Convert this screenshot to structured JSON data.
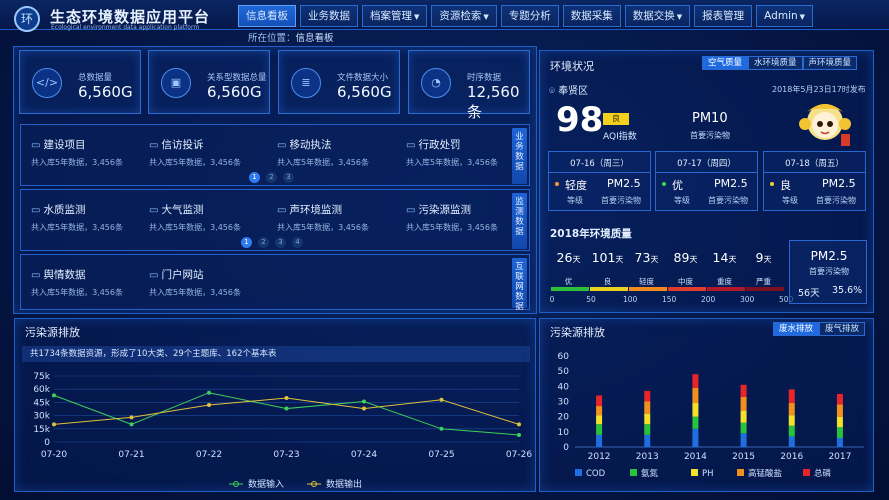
{
  "header": {
    "logo": "环",
    "title": "生态环境数据应用平台",
    "subtitle": "Ecological environment data application platform"
  },
  "nav": [
    {
      "label": "信息看板",
      "active": true,
      "caret": false
    },
    {
      "label": "业务数据",
      "active": false,
      "caret": false
    },
    {
      "label": "档案管理",
      "active": false,
      "caret": true
    },
    {
      "label": "资源检索",
      "active": false,
      "caret": true
    },
    {
      "label": "专题分析",
      "active": false,
      "caret": false
    },
    {
      "label": "数据采集",
      "active": false,
      "caret": false
    },
    {
      "label": "数据交换",
      "active": false,
      "caret": true
    },
    {
      "label": "报表管理",
      "active": false,
      "caret": false
    },
    {
      "label": "Admin",
      "active": false,
      "caret": true
    }
  ],
  "breadcrumb": {
    "prefix": "所在位置：",
    "current": "信息看板"
  },
  "stats": [
    {
      "icon": "</>",
      "label": "总数据量",
      "value": "6,560G"
    },
    {
      "icon": "▣",
      "label": "关系型数据总量",
      "value": "6,560G"
    },
    {
      "icon": "≣",
      "label": "文件数据大小",
      "value": "6,560G"
    },
    {
      "icon": "◔",
      "label": "时序数据",
      "value": "12,560条"
    }
  ],
  "groups": [
    {
      "side": "业务数据",
      "items": [
        {
          "name": "建设项目",
          "sub": "共入库5年数据，3,456条"
        },
        {
          "name": "信访投诉",
          "sub": "共入库5年数据，3,456条"
        },
        {
          "name": "移动执法",
          "sub": "共入库5年数据，3,456条"
        },
        {
          "name": "行政处罚",
          "sub": "共入库5年数据，3,456条"
        }
      ],
      "pages": [
        "1",
        "2",
        "3"
      ]
    },
    {
      "side": "监测数据",
      "items": [
        {
          "name": "水质监测",
          "sub": "共入库5年数据，3,456条"
        },
        {
          "name": "大气监测",
          "sub": "共入库5年数据，3,456条"
        },
        {
          "name": "声环境监测",
          "sub": "共入库5年数据，3,456条"
        },
        {
          "name": "污染源监测",
          "sub": "共入库5年数据，3,456条"
        }
      ],
      "pages": [
        "1",
        "2",
        "3",
        "4"
      ]
    },
    {
      "side": "互联网数据",
      "items": [
        {
          "name": "舆情数据",
          "sub": "共入库5年数据，3,456条"
        },
        {
          "name": "门户网站",
          "sub": "共入库5年数据，3,456条"
        }
      ],
      "pages": []
    }
  ],
  "env": {
    "title": "环境状况",
    "tabs": [
      "空气质量",
      "水环境质量",
      "声环境质量"
    ],
    "location": "奉贤区",
    "date": "2018年5月23日17时发布",
    "aqi": "98",
    "aqi_level": "良",
    "aqi_label": "AQI指数",
    "main_pollutant": "PM10",
    "main_pollutant_label": "首要污染物",
    "forecast": [
      {
        "date": "07-16（周三）",
        "level": "轻度",
        "level_color": "#f0a030",
        "level_label": "等级",
        "pollutant": "PM2.5",
        "pollutant_label": "首要污染物"
      },
      {
        "date": "07-17（周四）",
        "level": "优",
        "level_color": "#39d353",
        "level_label": "等级",
        "pollutant": "PM2.5",
        "pollutant_label": "首要污染物"
      },
      {
        "date": "07-18（周五）",
        "level": "良",
        "level_color": "#f0d030",
        "level_label": "等级",
        "pollutant": "PM2.5",
        "pollutant_label": "首要污染物"
      }
    ],
    "year_title": "2018年环境质量",
    "year_levels": [
      {
        "days": "26",
        "unit": "天",
        "label": "优",
        "color": "#2bbf3c"
      },
      {
        "days": "101",
        "unit": "天",
        "label": "良",
        "color": "#e8d21f"
      },
      {
        "days": "73",
        "unit": "天",
        "label": "轻度",
        "color": "#f08a1c"
      },
      {
        "days": "89",
        "unit": "天",
        "label": "中度",
        "color": "#e23b2b"
      },
      {
        "days": "14",
        "unit": "天",
        "label": "重度",
        "color": "#b3182a"
      },
      {
        "days": "9",
        "unit": "天",
        "label": "严重",
        "color": "#7a0f22"
      }
    ],
    "scale_ticks": [
      "0",
      "50",
      "100",
      "150",
      "200",
      "300",
      "500"
    ],
    "year_pollutant": "PM2.5",
    "year_pollutant_label": "首要污染物",
    "year_days": "56天",
    "year_pct": "35.6%"
  },
  "line_panel": {
    "title": "污染源排放",
    "summary": "共1734条数据资源，形成了10大类、29个主题库、162个基本表"
  },
  "bar_panel": {
    "title": "污染源排放",
    "tabs": [
      "废水排放",
      "废气排放"
    ]
  },
  "chart_data": [
    {
      "type": "line",
      "title": "",
      "x": [
        "07-20",
        "07-21",
        "07-22",
        "07-23",
        "07-24",
        "07-25",
        "07-26"
      ],
      "ylim": [
        0,
        75000
      ],
      "yticks": [
        "0",
        "15k",
        "30k",
        "45k",
        "60k",
        "75k"
      ],
      "series": [
        {
          "name": "数据输入",
          "color": "#3fd05a",
          "values": [
            53000,
            20000,
            56000,
            38000,
            46000,
            15000,
            8000
          ]
        },
        {
          "name": "数据输出",
          "color": "#e0c23a",
          "values": [
            20000,
            28000,
            42000,
            50000,
            38000,
            48000,
            20000
          ]
        }
      ],
      "legend": "bottom"
    },
    {
      "type": "bar",
      "title": "",
      "categories": [
        "2012",
        "2013",
        "2014",
        "2015",
        "2016",
        "2017"
      ],
      "ylim": [
        0,
        60
      ],
      "yticks": [
        "0",
        "10",
        "20",
        "30",
        "40",
        "50",
        "60"
      ],
      "series": [
        {
          "name": "COD",
          "color": "#1f6fe0",
          "values": [
            8,
            8,
            12,
            9,
            7,
            6
          ]
        },
        {
          "name": "氨氮",
          "color": "#28c23c",
          "values": [
            7,
            7,
            8,
            7,
            7,
            7
          ]
        },
        {
          "name": "PH",
          "color": "#f2e02a",
          "values": [
            6,
            7,
            9,
            8,
            7,
            7
          ]
        },
        {
          "name": "高锰酸盐",
          "color": "#f2901c",
          "values": [
            6,
            8,
            10,
            9,
            8,
            8
          ]
        },
        {
          "name": "总磷",
          "color": "#e8262a",
          "values": [
            7,
            7,
            9,
            8,
            9,
            7
          ]
        }
      ],
      "legend": "bottom"
    }
  ]
}
